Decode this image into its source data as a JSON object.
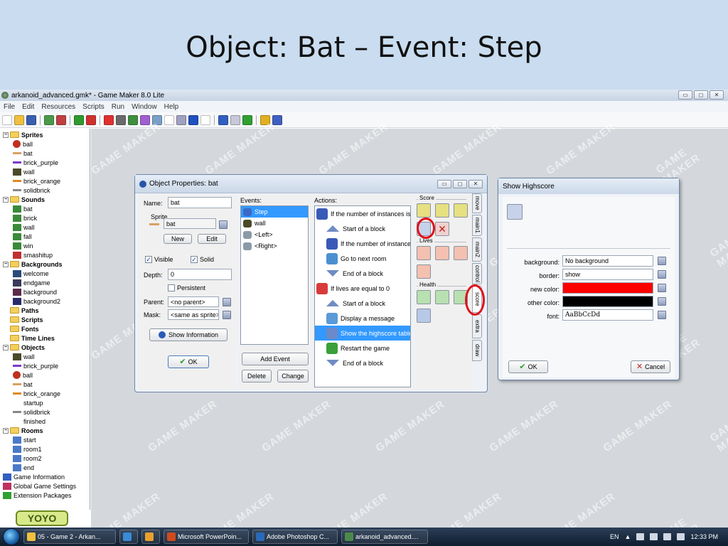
{
  "slide": {
    "title": "Object: Bat – Event: Step"
  },
  "app": {
    "title": "arkanoid_advanced.gmk* - Game Maker 8.0 Lite",
    "window_controls": [
      "▭",
      "◻",
      "✕"
    ],
    "menu": [
      "File",
      "Edit",
      "Resources",
      "Scripts",
      "Run",
      "Window",
      "Help"
    ]
  },
  "toolbar": {
    "icons": [
      {
        "name": "new-icon",
        "color": "#ffffff"
      },
      {
        "name": "open-icon",
        "color": "#f0c040"
      },
      {
        "name": "save-icon",
        "color": "#3a5fb0"
      },
      {
        "name": "sep"
      },
      {
        "name": "create-exe-icon",
        "color": "#4a9a4a"
      },
      {
        "name": "publish-icon",
        "color": "#c04040"
      },
      {
        "name": "sep"
      },
      {
        "name": "run-icon",
        "color": "#2e9a2e"
      },
      {
        "name": "debug-icon",
        "color": "#d03030"
      },
      {
        "name": "sep"
      },
      {
        "name": "add-sprite-icon",
        "color": "#e03030"
      },
      {
        "name": "add-sound-icon",
        "color": "#6a6a6a"
      },
      {
        "name": "add-background-icon",
        "color": "#3f8f3f"
      },
      {
        "name": "add-path-icon",
        "color": "#a060d0"
      },
      {
        "name": "add-script-icon",
        "color": "#7aa0c8"
      },
      {
        "name": "add-font-icon",
        "color": "#ffffff"
      },
      {
        "name": "add-timeline-icon",
        "color": "#a0a0c0"
      },
      {
        "name": "add-object-icon",
        "color": "#2050c0"
      },
      {
        "name": "add-room-icon",
        "color": "#ffffff"
      },
      {
        "name": "sep"
      },
      {
        "name": "game-info-icon",
        "color": "#3060c0"
      },
      {
        "name": "global-settings-icon",
        "color": "#c8c8d8"
      },
      {
        "name": "extension-icon",
        "color": "#30a030"
      },
      {
        "name": "sep"
      },
      {
        "name": "manual-icon",
        "color": "#e0b020"
      },
      {
        "name": "help-icon",
        "color": "#4060c0"
      }
    ]
  },
  "tree": {
    "rows": [
      {
        "type": "folder",
        "label": "Sprites",
        "exp": "−"
      },
      {
        "type": "child",
        "label": "ball",
        "icon": "#c03020",
        "shape": "round"
      },
      {
        "type": "child",
        "label": "bat",
        "icon": "#d8a060",
        "shape": "bar"
      },
      {
        "type": "child",
        "label": "brick_purple",
        "icon": "#7a3ac8",
        "shape": "bar"
      },
      {
        "type": "child",
        "label": "wall",
        "icon": "#4a4a2a",
        "shape": "square"
      },
      {
        "type": "child",
        "label": "brick_orange",
        "icon": "#e08a20",
        "shape": "bar"
      },
      {
        "type": "child",
        "label": "solidbrick",
        "icon": "#888888",
        "shape": "bar"
      },
      {
        "type": "folder",
        "label": "Sounds",
        "exp": "−"
      },
      {
        "type": "child",
        "label": "bat",
        "icon": "#3a8a3a",
        "shape": "square"
      },
      {
        "type": "child",
        "label": "brick",
        "icon": "#3a8a3a",
        "shape": "square"
      },
      {
        "type": "child",
        "label": "wall",
        "icon": "#3a8a3a",
        "shape": "square"
      },
      {
        "type": "child",
        "label": "fall",
        "icon": "#3a8a3a",
        "shape": "square"
      },
      {
        "type": "child",
        "label": "win",
        "icon": "#3a8a3a",
        "shape": "square"
      },
      {
        "type": "child",
        "label": "smashitup",
        "icon": "#c03030",
        "shape": "square"
      },
      {
        "type": "folder",
        "label": "Backgrounds",
        "exp": "−"
      },
      {
        "type": "child",
        "label": "welcome",
        "icon": "#2a4a7a",
        "shape": "square"
      },
      {
        "type": "child",
        "label": "endgame",
        "icon": "#3a3a5a",
        "shape": "square"
      },
      {
        "type": "child",
        "label": "background",
        "icon": "#5a2a4a",
        "shape": "square"
      },
      {
        "type": "child",
        "label": "background2",
        "icon": "#2a2a6a",
        "shape": "square"
      },
      {
        "type": "folder",
        "label": "Paths",
        "exp": ""
      },
      {
        "type": "folder",
        "label": "Scripts",
        "exp": ""
      },
      {
        "type": "folder",
        "label": "Fonts",
        "exp": ""
      },
      {
        "type": "folder",
        "label": "Time Lines",
        "exp": ""
      },
      {
        "type": "folder",
        "label": "Objects",
        "exp": "−"
      },
      {
        "type": "child",
        "label": "wall",
        "icon": "#4a4a2a",
        "shape": "square"
      },
      {
        "type": "child",
        "label": "brick_purple",
        "icon": "#7a3ac8",
        "shape": "bar"
      },
      {
        "type": "child",
        "label": "ball",
        "icon": "#c03020",
        "shape": "round"
      },
      {
        "type": "child",
        "label": "bat",
        "icon": "#d8a060",
        "shape": "bar"
      },
      {
        "type": "child",
        "label": "brick_orange",
        "icon": "#e08a20",
        "shape": "bar"
      },
      {
        "type": "child",
        "label": "startup",
        "icon": "",
        "shape": "none"
      },
      {
        "type": "child",
        "label": "solidbrick",
        "icon": "#888888",
        "shape": "bar"
      },
      {
        "type": "child",
        "label": "finished",
        "icon": "",
        "shape": "none"
      },
      {
        "type": "folder",
        "label": "Rooms",
        "exp": "−"
      },
      {
        "type": "child",
        "label": "start",
        "icon": "#4a7ac8",
        "shape": "square"
      },
      {
        "type": "child",
        "label": "room1",
        "icon": "#4a7ac8",
        "shape": "square"
      },
      {
        "type": "child",
        "label": "room2",
        "icon": "#4a7ac8",
        "shape": "square"
      },
      {
        "type": "child",
        "label": "end",
        "icon": "#4a7ac8",
        "shape": "square"
      },
      {
        "type": "item",
        "label": "Game Information",
        "icon": "#3060c0",
        "shape": "square"
      },
      {
        "type": "item",
        "label": "Global Game Settings",
        "icon": "#c03060",
        "shape": "square"
      },
      {
        "type": "item",
        "label": "Extension Packages",
        "icon": "#30a030",
        "shape": "square"
      }
    ],
    "logo_text": "YOYO"
  },
  "watermark": "GAME MAKER",
  "object_window": {
    "title": "Object Properties: bat",
    "name_label": "Name:",
    "name_value": "bat",
    "sprite_label": "Sprite",
    "sprite_value": "bat",
    "new_label": "New",
    "edit_label": "Edit",
    "visible_label": "Visible",
    "solid_label": "Solid",
    "depth_label": "Depth:",
    "depth_value": "0",
    "persistent_label": "Persistent",
    "parent_label": "Parent:",
    "parent_value": "<no parent>",
    "mask_label": "Mask:",
    "mask_value": "<same as sprite>",
    "show_info_label": "Show Information",
    "ok_label": "OK",
    "events_label": "Events:",
    "events": [
      {
        "label": "Step",
        "selected": true,
        "icon": "#3a6ac8"
      },
      {
        "label": "wall",
        "selected": false,
        "icon": "#4a4a2a"
      },
      {
        "label": "<Left>",
        "selected": false,
        "icon": "#8a9aa8"
      },
      {
        "label": "<Right>",
        "selected": false,
        "icon": "#8a9aa8"
      }
    ],
    "add_event_label": "Add Event",
    "delete_label": "Delete",
    "change_label": "Change",
    "actions_label": "Actions:",
    "actions": [
      {
        "label": "If the number of instances is",
        "kind": "icon",
        "color": "#3a5ab8",
        "indent": false,
        "selected": false
      },
      {
        "label": "Start of a block",
        "kind": "up",
        "indent": true,
        "selected": false
      },
      {
        "label": "If the number of instances",
        "kind": "icon",
        "color": "#3a5ab8",
        "indent": true,
        "selected": false
      },
      {
        "label": "Go to next room",
        "kind": "icon",
        "color": "#4a90d0",
        "indent": true,
        "selected": false
      },
      {
        "label": "End of a block",
        "kind": "down",
        "indent": true,
        "selected": false
      },
      {
        "label": "If lives are equal to 0",
        "kind": "icon",
        "color": "#d83a3a",
        "indent": false,
        "selected": false
      },
      {
        "label": "Start of a block",
        "kind": "up",
        "indent": true,
        "selected": false
      },
      {
        "label": "Display a message",
        "kind": "icon",
        "color": "#5a9ad8",
        "indent": true,
        "selected": false
      },
      {
        "label": "Show the highscore table",
        "kind": "icon",
        "color": "#6a8ac8",
        "indent": true,
        "selected": true
      },
      {
        "label": "Restart the game",
        "kind": "icon",
        "color": "#3aa03a",
        "indent": true,
        "selected": false
      },
      {
        "label": "End of a block",
        "kind": "down",
        "indent": true,
        "selected": false
      }
    ],
    "groups": {
      "score": "Score",
      "lives": "Lives",
      "health": "Health"
    },
    "tabs": [
      "move",
      "main1",
      "main2",
      "control",
      "score",
      "extra",
      "draw"
    ],
    "active_tab": "score"
  },
  "highscore_dialog": {
    "title": "Show Highscore",
    "background_label": "background:",
    "background_value": "No background",
    "border_label": "border:",
    "border_value": "show",
    "new_color_label": "new color:",
    "new_color": "#ff0000",
    "other_color_label": "other color:",
    "other_color": "#000000",
    "font_label": "font:",
    "font_value": "AaBbCcDd",
    "ok_label": "OK",
    "cancel_label": "Cancel"
  },
  "taskbar": {
    "tasks": [
      {
        "label": "05 - Game 2 - Arkan...",
        "color": "#f0c040"
      },
      {
        "label": "",
        "color": "#3a8ad8"
      },
      {
        "label": "",
        "color": "#e8a030"
      },
      {
        "label": "Microsoft PowerPoin...",
        "color": "#d04a20"
      },
      {
        "label": "Adobe Photoshop C...",
        "color": "#2a6ab8"
      },
      {
        "label": "arkanoid_advanced....",
        "color": "#4a8a4a"
      }
    ],
    "lang": "EN",
    "clock": "12:33 PM"
  }
}
